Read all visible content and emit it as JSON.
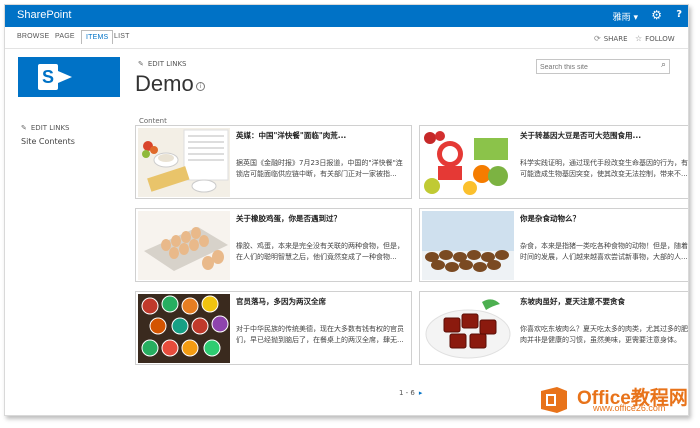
{
  "suite_bar": {
    "brand": "SharePoint",
    "user": "雅雨 ▾",
    "gear": "⚙",
    "help": "?"
  },
  "ribbon": {
    "tabs": [
      "BROWSE",
      "PAGE",
      "ITEMS",
      "LIST"
    ],
    "active_tab": "ITEMS",
    "share": "SHARE",
    "follow": "FOLLOW"
  },
  "header": {
    "edit_links": "EDIT LINKS",
    "site_title": "Demo",
    "info_icon": "i",
    "search_placeholder": "Search this site"
  },
  "left_nav": {
    "edit_links": "EDIT LINKS",
    "items": [
      "Site Contents"
    ]
  },
  "content": {
    "label": "Content",
    "cards": [
      {
        "title": "英媒：中国\"洋快餐\"面临\"肉荒...",
        "desc": "据英国《金融时报》7月23日报道，中国的\"洋快餐\"连锁店可能面临供应链中断，有关部门正对一家被指...",
        "image": "breakfast-photo"
      },
      {
        "title": "关于转基因大豆是否可大范围食用...",
        "desc": "科学实践证明，通过现代手段改变生命基因的行为，有可能造成生物基因突变，使其改变无法控制，带来不...",
        "image": "vegetables-scale-photo"
      },
      {
        "title": "关于橡胶鸡蛋，你是否遇到过？",
        "desc": "橡胶、鸡蛋，本来是完全没有关联的两种食物，但是，在人们的聪明智慧之后，他们竟然变成了一种食物...",
        "image": "eggs-photo"
      },
      {
        "title": "你是杂食动物么？",
        "desc": "杂食，本来是指猪一类吃各种食物的动物！但是，随着时间的发展，人们越来越喜欢尝试新事物，大部的人...",
        "image": "dried-food-photo"
      },
      {
        "title": "官员落马，多因为两汉全席",
        "desc": "对于中华民族的传统美德，现在大多数有钱有权的官员们，早已经抛到脑后了，在餐桌上的两汉全席，肆无...",
        "image": "banquet-photo"
      },
      {
        "title": "东坡肉虽好，夏天注意不要贪食",
        "desc": "你喜欢吃东坡肉么？夏天吃太多的肉类，尤其过多的肥肉并非是健康的习惯，虽然美味，更需要注意身体。",
        "image": "dongpo-pork-photo"
      }
    ]
  },
  "pager": {
    "range": "1 - 6",
    "next": "▸"
  },
  "watermark": {
    "brand": "Office教程网",
    "url": "www.office26.com"
  },
  "colors": {
    "accent": "#0072c6",
    "watermark": "#e8731a"
  }
}
